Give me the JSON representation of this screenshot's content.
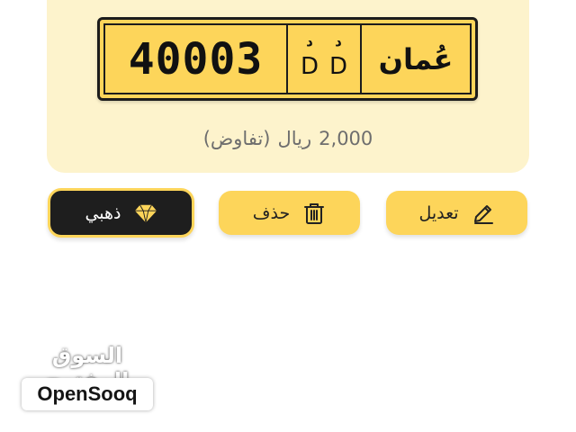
{
  "plate": {
    "number": "40003",
    "letters": [
      {
        "arabic": "د",
        "latin": "D"
      },
      {
        "arabic": "د",
        "latin": "D"
      }
    ],
    "country": "عُمان"
  },
  "price": {
    "amount": "2,000",
    "currency": "ريال",
    "note": "(تفاوض)"
  },
  "actions": {
    "edit_label": "تعديل",
    "delete_label": "حذف",
    "gold_label": "ذهبي"
  },
  "brand": {
    "arabic": "السوق المفتوح",
    "latin": "OpenSooq"
  },
  "colors": {
    "accent": "#fdd55a",
    "card_background": "#fdf3cc",
    "dark_button": "#1e1e1e"
  },
  "icons": {
    "edit": "pencil-icon",
    "delete": "trash-icon",
    "gold": "diamond-icon"
  }
}
